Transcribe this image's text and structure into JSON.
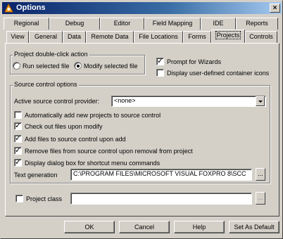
{
  "window": {
    "title": "Options",
    "minimize": "_",
    "maximize": "□",
    "close": "×"
  },
  "tabs_row1": [
    "Regional",
    "Debug",
    "Editor",
    "Field Mapping",
    "IDE",
    "Reports"
  ],
  "tabs_row2": [
    "View",
    "General",
    "Data",
    "Remote Data",
    "File Locations",
    "Forms",
    "Projects",
    "Controls"
  ],
  "project": {
    "group_label": "Project double-click action",
    "radio_run": "Run selected file",
    "radio_modify": "Modify selected file",
    "prompt_wizards": "Prompt for Wizards",
    "display_icons": "Display user-defined container icons"
  },
  "source_control": {
    "group_label": "Source control options",
    "provider_label": "Active source control provider:",
    "provider_value": "<none>",
    "auto_add": "Automatically add new projects to source control",
    "check_out": "Check out files upon modify",
    "add_files": "Add files to source control upon add",
    "remove_files": "Remove files from source control upon removal from project",
    "display_dialog": "Display dialog box for shortcut menu commands",
    "text_gen_label": "Text generation",
    "text_gen_value": "C:\\PROGRAM FILES\\MICROSOFT VISUAL FOXPRO 8\\SCC",
    "ellipsis": "..."
  },
  "project_class": {
    "label": "Project class",
    "value": "",
    "ellipsis": "..."
  },
  "buttons": {
    "ok": "OK",
    "cancel": "Cancel",
    "help": "Help",
    "set_default": "Set As Default"
  }
}
